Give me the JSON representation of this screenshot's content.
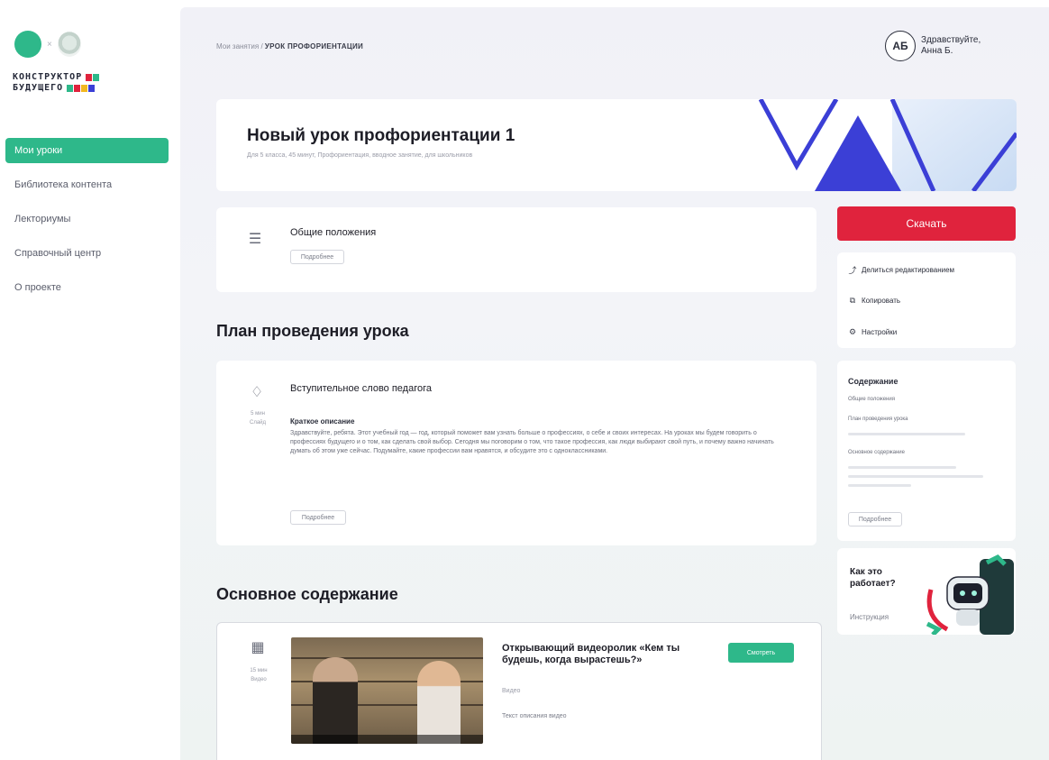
{
  "sidebar": {
    "brand_line1": "КОНСТРУКТОР",
    "brand_line2": "БУДУЩЕГО",
    "nav": [
      {
        "label": "Мои уроки",
        "active": true
      },
      {
        "label": "Библиотека контента",
        "active": false
      },
      {
        "label": "Лекториумы",
        "active": false
      },
      {
        "label": "Справочный центр",
        "active": false
      },
      {
        "label": "О проекте",
        "active": false
      }
    ]
  },
  "header": {
    "breadcrumb_parent": "Мои занятия /",
    "breadcrumb_current": "УРОК ПРОФОРИЕНТАЦИИ",
    "user": {
      "initials": "АБ",
      "line1": "Здравствуйте,",
      "line2": "Анна Б."
    }
  },
  "lesson": {
    "title": "Новый урок профориентации 1",
    "subtitle": "Для 5 класса, 45 минут, Профориентация, вводное занятие, для школьников"
  },
  "general": {
    "title": "Общие положения",
    "button": "Подробнее"
  },
  "plan": {
    "heading": "План проведения урока",
    "intro": {
      "title": "Вступительное слово педагога",
      "time_label": "5 мин",
      "time_sub": "Слайд",
      "subheading": "Краткое описание",
      "paragraph": "Здравствуйте, ребята. Этот учебный год — год, который поможет вам узнать больше о профессиях, о себе и своих интересах. На уроках мы будем говорить о профессиях будущего и о том, как сделать свой выбор. Сегодня мы поговорим о том, что такое профессия, как люди выбирают свой путь, и почему важно начинать думать об этом уже сейчас. Подумайте, какие профессии вам нравятся, и обсудите это с одноклассниками.",
      "button": "Подробнее"
    }
  },
  "main_content": {
    "heading": "Основное содержание",
    "video": {
      "time_label": "15 мин",
      "time_sub": "Видео",
      "title": "Открывающий видеоролик «Кем ты будешь, когда вырастешь?»",
      "meta": "Видео",
      "description": "Текст описания видео",
      "button": "Смотреть"
    }
  },
  "right": {
    "download": "Скачать",
    "actions": [
      {
        "icon": "share-icon",
        "glyph": "⤴",
        "label": "Делиться редактированием"
      },
      {
        "icon": "copy-icon",
        "glyph": "⧉",
        "label": "Копировать"
      },
      {
        "icon": "settings-icon",
        "glyph": "⚙",
        "label": "Настройки"
      }
    ],
    "contents": {
      "heading": "Содержание",
      "item1": "Общие положения",
      "item2": "План проведения урока",
      "item3": "Основное содержание",
      "button": "Подробнее"
    },
    "how": {
      "question": "Как это работает?",
      "link": "Инструкция"
    }
  },
  "colors": {
    "accent_green": "#2eb88a",
    "download_red": "#e0233d",
    "deco_blue": "#3b3fd6"
  }
}
